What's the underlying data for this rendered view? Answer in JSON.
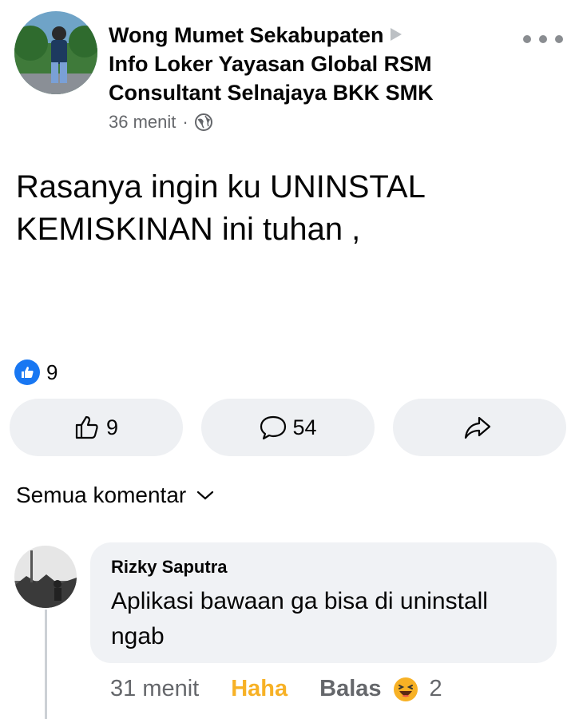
{
  "post": {
    "author_line1": "Wong Mumet Sekabupaten",
    "author_line2": "Info Loker Yayasan Global RSM",
    "author_line3": "Consultant Selnajaya BKK SMK",
    "time": "36 menit",
    "separator": "·",
    "text": "Rasanya ingin ku UNINSTAL KEMISKINAN ini tuhan ,",
    "reaction_count": "9"
  },
  "actions": {
    "like_count": "9",
    "comment_count": "54"
  },
  "comments_filter": {
    "label": "Semua komentar"
  },
  "comment": {
    "author": "Rizky Saputra",
    "text": "Aplikasi bawaan ga bisa di uninstall ngab",
    "time": "31 menit",
    "reaction_label": "Haha",
    "reply_label": "Balas",
    "reaction_count": "2"
  },
  "colors": {
    "like_blue": "#1877f2",
    "haha_yellow": "#f7b125",
    "meta_gray": "#65676b",
    "button_bg": "#eef0f3",
    "bubble_bg": "#f0f2f5"
  },
  "icons": [
    "globe-icon",
    "more-icon",
    "like-icon",
    "comment-icon",
    "share-icon",
    "chevron-down-icon",
    "haha-icon"
  ]
}
